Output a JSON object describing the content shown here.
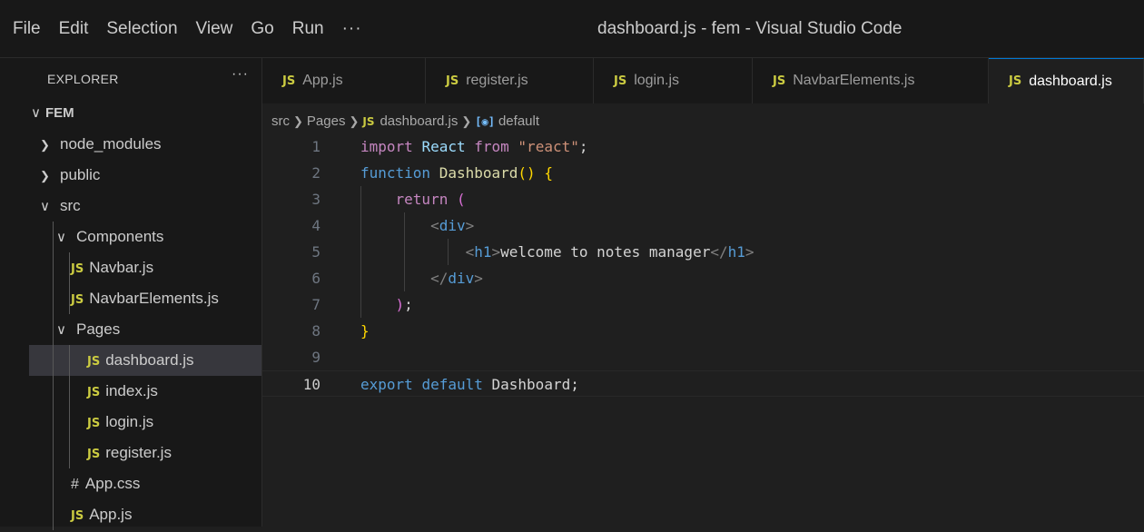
{
  "menu": {
    "items": [
      "File",
      "Edit",
      "Selection",
      "View",
      "Go",
      "Run"
    ],
    "more": "···"
  },
  "window_title": "dashboard.js - fem - Visual Studio Code",
  "sidebar": {
    "title": "EXPLORER",
    "more": "···",
    "root": "FEM",
    "items": [
      {
        "label": "node_modules",
        "type": "folder",
        "expanded": false
      },
      {
        "label": "public",
        "type": "folder",
        "expanded": false
      },
      {
        "label": "src",
        "type": "folder",
        "expanded": true
      },
      {
        "label": "Components",
        "type": "folder",
        "expanded": true
      },
      {
        "label": "Navbar.js",
        "type": "js"
      },
      {
        "label": "NavbarElements.js",
        "type": "js"
      },
      {
        "label": "Pages",
        "type": "folder",
        "expanded": true
      },
      {
        "label": "dashboard.js",
        "type": "js",
        "selected": true
      },
      {
        "label": "index.js",
        "type": "js"
      },
      {
        "label": "login.js",
        "type": "js"
      },
      {
        "label": "register.js",
        "type": "js"
      },
      {
        "label": "App.css",
        "type": "css"
      },
      {
        "label": "App.js",
        "type": "js"
      }
    ]
  },
  "tabs": [
    {
      "label": "App.js",
      "active": false
    },
    {
      "label": "register.js",
      "active": false
    },
    {
      "label": "login.js",
      "active": false
    },
    {
      "label": "NavbarElements.js",
      "active": false
    },
    {
      "label": "dashboard.js",
      "active": true
    }
  ],
  "badges": {
    "js": "JS",
    "css": "#"
  },
  "breadcrumb": {
    "items": [
      "src",
      "Pages",
      "dashboard.js",
      "default"
    ]
  },
  "editor": {
    "current_line": 10,
    "lines": [
      {
        "n": "1",
        "tokens": [
          [
            "kw1",
            "import"
          ],
          [
            "plain",
            " "
          ],
          [
            "id",
            "React"
          ],
          [
            "plain",
            " "
          ],
          [
            "kw1",
            "from"
          ],
          [
            "plain",
            " "
          ],
          [
            "str",
            "\"react\""
          ],
          [
            "plain",
            ";"
          ]
        ]
      },
      {
        "n": "2",
        "tokens": [
          [
            "kw2",
            "function"
          ],
          [
            "plain",
            " "
          ],
          [
            "fn",
            "Dashboard"
          ],
          [
            "br1",
            "()"
          ],
          [
            "plain",
            " "
          ],
          [
            "br1",
            "{"
          ]
        ]
      },
      {
        "n": "3",
        "tokens": [
          [
            "plain",
            "    "
          ],
          [
            "kw1",
            "return"
          ],
          [
            "plain",
            " "
          ],
          [
            "br2",
            "("
          ]
        ]
      },
      {
        "n": "4",
        "tokens": [
          [
            "plain",
            "        "
          ],
          [
            "tagp",
            "<"
          ],
          [
            "tag",
            "div"
          ],
          [
            "tagp",
            ">"
          ]
        ]
      },
      {
        "n": "5",
        "tokens": [
          [
            "plain",
            "            "
          ],
          [
            "tagp",
            "<"
          ],
          [
            "tag",
            "h1"
          ],
          [
            "tagp",
            ">"
          ],
          [
            "plain",
            "welcome to notes manager"
          ],
          [
            "tagp",
            "</"
          ],
          [
            "tag",
            "h1"
          ],
          [
            "tagp",
            ">"
          ]
        ]
      },
      {
        "n": "6",
        "tokens": [
          [
            "plain",
            "        "
          ],
          [
            "tagp",
            "</"
          ],
          [
            "tag",
            "div"
          ],
          [
            "tagp",
            ">"
          ]
        ]
      },
      {
        "n": "7",
        "tokens": [
          [
            "plain",
            "    "
          ],
          [
            "br2",
            ")"
          ],
          [
            "plain",
            ";"
          ]
        ]
      },
      {
        "n": "8",
        "tokens": [
          [
            "br1",
            "}"
          ]
        ]
      },
      {
        "n": "9",
        "tokens": []
      },
      {
        "n": "10",
        "tokens": [
          [
            "kw2",
            "export"
          ],
          [
            "plain",
            " "
          ],
          [
            "kw2",
            "default"
          ],
          [
            "plain",
            " "
          ],
          [
            "plain",
            "Dashboard"
          ],
          [
            "plain",
            ";"
          ]
        ]
      }
    ]
  },
  "colors": {
    "accent": "#0078d4",
    "js_badge": "#cbcb41",
    "background": "#1f1f1f",
    "sidebar": "#181818"
  }
}
